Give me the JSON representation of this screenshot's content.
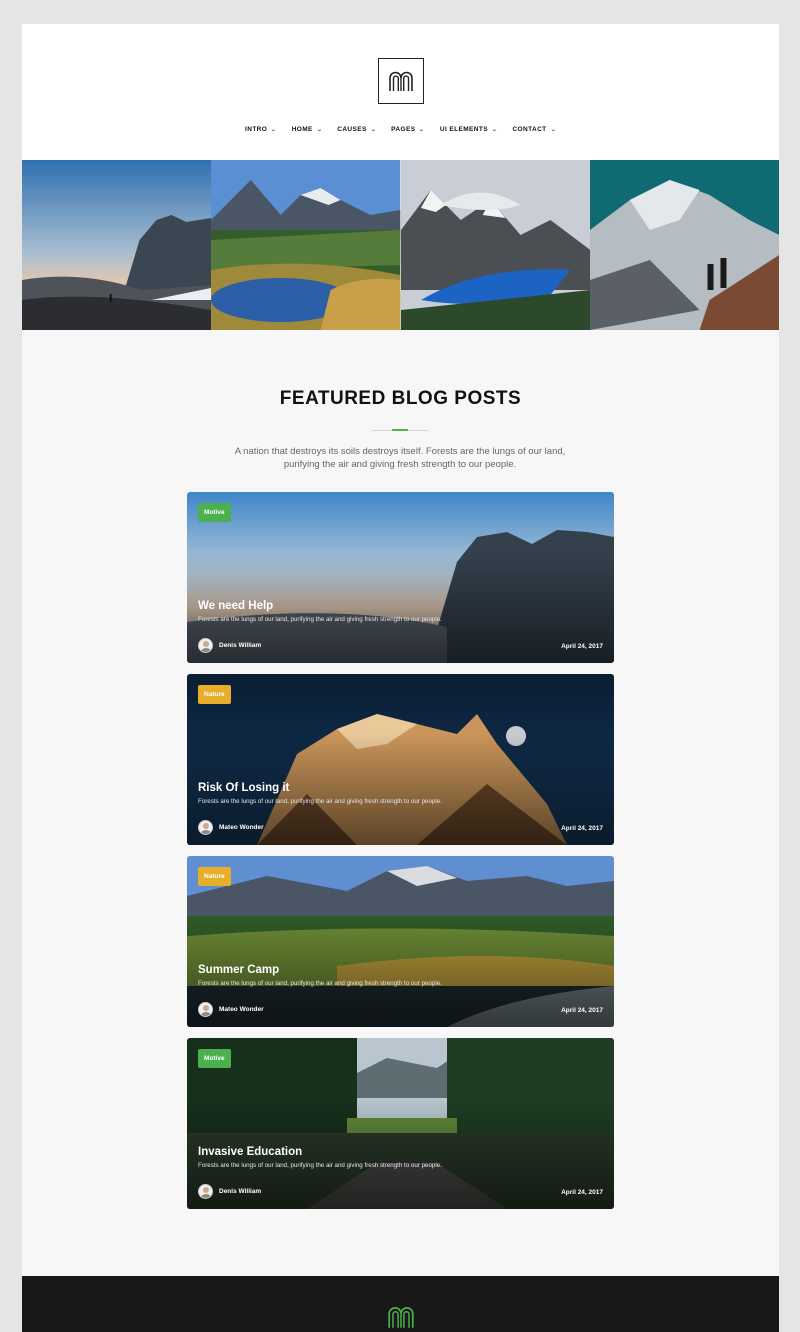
{
  "header": {
    "logo_icon": "m-arch-logo-icon",
    "nav": [
      {
        "label": "INTRO"
      },
      {
        "label": "HOME"
      },
      {
        "label": "CAUSES"
      },
      {
        "label": "PAGES"
      },
      {
        "label": "UI ELEMENTS"
      },
      {
        "label": "CONTACT"
      }
    ]
  },
  "hero": {
    "images": [
      "misty-mountain-hiker",
      "alpine-lake-forest",
      "glacier-lake",
      "snowy-peak-hikers"
    ]
  },
  "featured": {
    "title": "FEATURED BLOG POSTS",
    "subtitle": "A nation that destroys its soils destroys itself. Forests are the lungs of our land, purifying the air and giving fresh strength to our people.",
    "accent_color": "#4caf50"
  },
  "posts": [
    {
      "badge": "Motive",
      "badge_color": "#4caf50",
      "title": "We need Help",
      "excerpt": "Forests are the lungs of our land, purifying the air and giving fresh strength to our people.",
      "author": "Denis William",
      "date": "April 24, 2017"
    },
    {
      "badge": "Nature",
      "badge_color": "#e7ae2c",
      "title": "Risk Of Losing it",
      "excerpt": "Forests are the lungs of our land, purifying the air and giving fresh strength to our people.",
      "author": "Mateo Wonder",
      "date": "April 24, 2017"
    },
    {
      "badge": "Nature",
      "badge_color": "#e7ae2c",
      "title": "Summer Camp",
      "excerpt": "Forests are the lungs of our land, purifying the air and giving fresh strength to our people.",
      "author": "Mateo Wonder",
      "date": "April 24, 2017"
    },
    {
      "badge": "Motive",
      "badge_color": "#4caf50",
      "title": "Invasive Education",
      "excerpt": "Forests are the lungs of our land, purifying the air and giving fresh strength to our people.",
      "author": "Denis William",
      "date": "April 24, 2017"
    }
  ],
  "footer": {
    "logo_icon": "m-arch-logo-icon",
    "logo_color": "#4caf50"
  }
}
